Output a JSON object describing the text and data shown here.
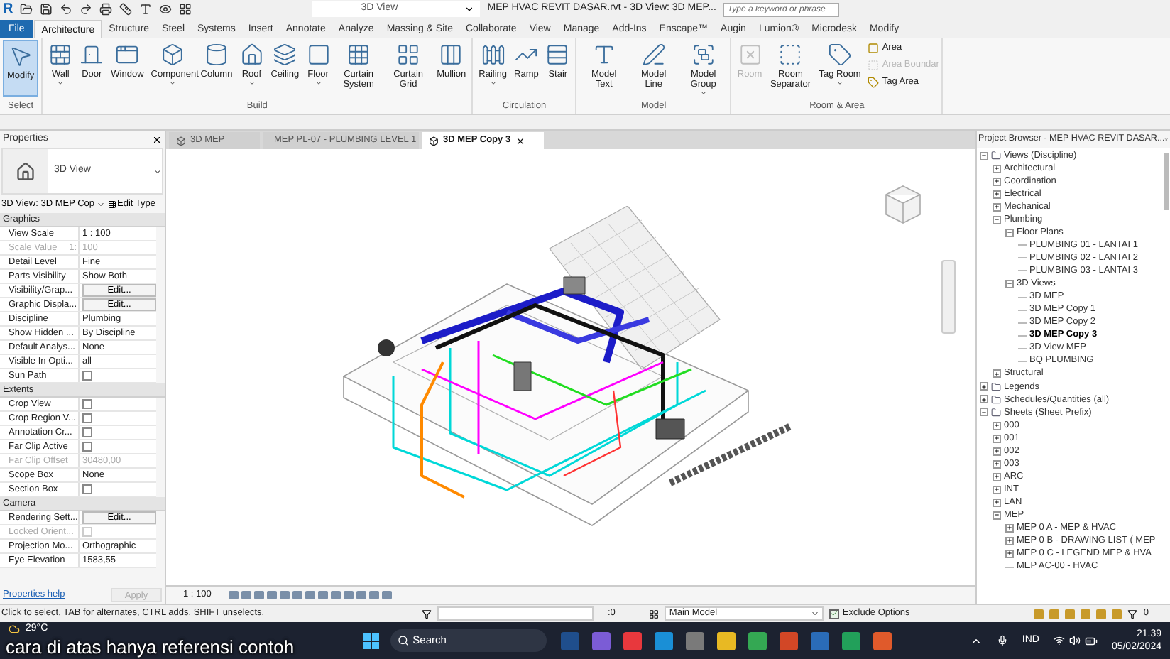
{
  "title_bar": {
    "app_logo": "R",
    "view_selector": "3D View",
    "title": "MEP HVAC REVIT DASAR.rvt - 3D View: 3D MEP...",
    "search": {
      "placeholder": "Type a keyword or phrase"
    }
  },
  "ribbon_tabs": [
    {
      "label": "File",
      "kind": "file",
      "selected": false
    },
    {
      "label": "Architecture",
      "kind": "tab",
      "selected": true
    },
    {
      "label": "Structure",
      "kind": "tab",
      "selected": false
    },
    {
      "label": "Steel",
      "kind": "tab",
      "selected": false
    },
    {
      "label": "Systems",
      "kind": "tab",
      "selected": false
    },
    {
      "label": "Insert",
      "kind": "tab",
      "selected": false
    },
    {
      "label": "Annotate",
      "kind": "tab",
      "selected": false
    },
    {
      "label": "Analyze",
      "kind": "tab",
      "selected": false
    },
    {
      "label": "Massing & Site",
      "kind": "tab",
      "selected": false
    },
    {
      "label": "Collaborate",
      "kind": "tab",
      "selected": false
    },
    {
      "label": "View",
      "kind": "tab",
      "selected": false
    },
    {
      "label": "Manage",
      "kind": "tab",
      "selected": false
    },
    {
      "label": "Add-Ins",
      "kind": "tab",
      "selected": false
    },
    {
      "label": "Enscape™",
      "kind": "tab",
      "selected": false
    },
    {
      "label": "Augin",
      "kind": "tab",
      "selected": false
    },
    {
      "label": "Lumion®",
      "kind": "tab",
      "selected": false
    },
    {
      "label": "Microdesk",
      "kind": "tab",
      "selected": false
    },
    {
      "label": "Modify",
      "kind": "tab",
      "selected": false
    }
  ],
  "ribbon_panels": [
    {
      "label": "Select",
      "buttons": [
        {
          "label": "Modify",
          "selected": true,
          "disabled": false,
          "dropdown": false
        }
      ]
    },
    {
      "label": "Build",
      "buttons": [
        {
          "label": "Wall",
          "selected": false,
          "disabled": false,
          "dropdown": true
        },
        {
          "label": "Door",
          "selected": false,
          "disabled": false,
          "dropdown": false
        },
        {
          "label": "Window",
          "selected": false,
          "disabled": false,
          "dropdown": false
        },
        {
          "label": "Component",
          "selected": false,
          "disabled": false,
          "dropdown": true
        },
        {
          "label": "Column",
          "selected": false,
          "disabled": false,
          "dropdown": false
        },
        {
          "label": "Roof",
          "selected": false,
          "disabled": false,
          "dropdown": true
        },
        {
          "label": "Ceiling",
          "selected": false,
          "disabled": false,
          "dropdown": false
        },
        {
          "label": "Floor",
          "selected": false,
          "disabled": false,
          "dropdown": true
        },
        {
          "label": "Curtain System",
          "selected": false,
          "disabled": false,
          "dropdown": false
        },
        {
          "label": "Curtain Grid",
          "selected": false,
          "disabled": false,
          "dropdown": false
        },
        {
          "label": "Mullion",
          "selected": false,
          "disabled": false,
          "dropdown": false
        }
      ]
    },
    {
      "label": "Circulation",
      "buttons": [
        {
          "label": "Railing",
          "selected": false,
          "disabled": false,
          "dropdown": true
        },
        {
          "label": "Ramp",
          "selected": false,
          "disabled": false,
          "dropdown": false
        },
        {
          "label": "Stair",
          "selected": false,
          "disabled": false,
          "dropdown": false
        }
      ]
    },
    {
      "label": "Model",
      "buttons": [
        {
          "label": "Model Text",
          "selected": false,
          "disabled": false,
          "dropdown": false
        },
        {
          "label": "Model Line",
          "selected": false,
          "disabled": false,
          "dropdown": false
        },
        {
          "label": "Model Group",
          "selected": false,
          "disabled": false,
          "dropdown": true
        }
      ]
    },
    {
      "label": "Room & Area",
      "buttons": [
        {
          "label": "Room",
          "selected": false,
          "disabled": true,
          "dropdown": false
        },
        {
          "label": "Room Separator",
          "selected": false,
          "disabled": false,
          "dropdown": false
        },
        {
          "label": "Tag Room",
          "selected": false,
          "disabled": false,
          "dropdown": true
        }
      ],
      "small_buttons": [
        {
          "label": "Area",
          "disabled": false
        },
        {
          "label": "Area Boundar",
          "disabled": true
        },
        {
          "label": "Tag Area",
          "disabled": false
        }
      ]
    }
  ],
  "properties": {
    "title": "Properties",
    "type_name": "3D View",
    "instance": "3D View: 3D MEP Cop",
    "edit_type": "Edit Type",
    "sections": [
      {
        "name": "Graphics",
        "rows": [
          {
            "label": "View Scale",
            "kind": "text",
            "value": "1 : 100",
            "disabled": false
          },
          {
            "label": "Scale Value",
            "kind": "text",
            "value_prefix": "1:",
            "value": "100",
            "disabled": true
          },
          {
            "label": "Detail Level",
            "kind": "text",
            "value": "Fine",
            "disabled": false
          },
          {
            "label": "Parts Visibility",
            "kind": "text",
            "value": "Show Both",
            "disabled": false
          },
          {
            "label": "Visibility/Grap...",
            "kind": "button",
            "value": "Edit...",
            "disabled": false
          },
          {
            "label": "Graphic Displa...",
            "kind": "button",
            "value": "Edit...",
            "disabled": false
          },
          {
            "label": "Discipline",
            "kind": "text",
            "value": "Plumbing",
            "disabled": false
          },
          {
            "label": "Show Hidden ...",
            "kind": "text",
            "value": "By Discipline",
            "disabled": false
          },
          {
            "label": "Default Analys...",
            "kind": "text",
            "value": "None",
            "disabled": false
          },
          {
            "label": "Visible In Opti...",
            "kind": "text",
            "value": "all",
            "disabled": false
          },
          {
            "label": "Sun Path",
            "kind": "checkbox",
            "checked": false,
            "disabled": false
          }
        ]
      },
      {
        "name": "Extents",
        "rows": [
          {
            "label": "Crop View",
            "kind": "checkbox",
            "checked": false,
            "disabled": false
          },
          {
            "label": "Crop Region V...",
            "kind": "checkbox",
            "checked": false,
            "disabled": false
          },
          {
            "label": "Annotation Cr...",
            "kind": "checkbox",
            "checked": false,
            "disabled": false
          },
          {
            "label": "Far Clip Active",
            "kind": "checkbox",
            "checked": false,
            "disabled": false
          },
          {
            "label": "Far Clip Offset",
            "kind": "text",
            "value": "30480,00",
            "disabled": true
          },
          {
            "label": "Scope Box",
            "kind": "text",
            "value": "None",
            "disabled": false
          },
          {
            "label": "Section Box",
            "kind": "checkbox",
            "checked": false,
            "disabled": false
          }
        ]
      },
      {
        "name": "Camera",
        "rows": [
          {
            "label": "Rendering Sett...",
            "kind": "button",
            "value": "Edit...",
            "disabled": false
          },
          {
            "label": "Locked Orient...",
            "kind": "checkbox",
            "checked": false,
            "disabled": true
          },
          {
            "label": "Projection Mo...",
            "kind": "text",
            "value": "Orthographic",
            "disabled": false
          },
          {
            "label": "Eye Elevation",
            "kind": "text",
            "value": "1583,55",
            "disabled": false
          }
        ]
      }
    ],
    "help_link": "Properties help",
    "apply": "Apply"
  },
  "view_tabs": [
    {
      "label": "3D MEP",
      "selected": false
    },
    {
      "label": "MEP PL-07 - PLUMBING LEVEL 1",
      "selected": false
    },
    {
      "label": "3D MEP Copy 3",
      "selected": true
    }
  ],
  "view_control_bar": {
    "scale": "1 : 100"
  },
  "project_browser": {
    "title": "Project Browser - MEP HVAC REVIT DASAR...",
    "tree": [
      {
        "label": "Views (Discipline)",
        "expanded": true,
        "children": [
          {
            "label": "Architectural",
            "expanded": false
          },
          {
            "label": "Coordination",
            "expanded": false
          },
          {
            "label": "Electrical",
            "expanded": false
          },
          {
            "label": "Mechanical",
            "expanded": false
          },
          {
            "label": "Plumbing",
            "expanded": true,
            "children": [
              {
                "label": "Floor Plans",
                "expanded": true,
                "children": [
                  {
                    "label": "PLUMBING 01 - LANTAI 1",
                    "selected": false
                  },
                  {
                    "label": "PLUMBING 02 - LANTAI 2",
                    "selected": false
                  },
                  {
                    "label": "PLUMBING 03 - LANTAI 3",
                    "selected": false
                  }
                ]
              },
              {
                "label": "3D Views",
                "expanded": true,
                "children": [
                  {
                    "label": "3D MEP",
                    "selected": false
                  },
                  {
                    "label": "3D MEP Copy 1",
                    "selected": false
                  },
                  {
                    "label": "3D MEP Copy 2",
                    "selected": false
                  },
                  {
                    "label": "3D MEP Copy 3",
                    "selected": true
                  },
                  {
                    "label": "3D View MEP",
                    "selected": false
                  },
                  {
                    "label": "BQ PLUMBING",
                    "selected": false
                  }
                ]
              }
            ]
          },
          {
            "label": "Structural",
            "expanded": false
          }
        ]
      },
      {
        "label": "Legends",
        "expanded": false
      },
      {
        "label": "Schedules/Quantities (all)",
        "expanded": false
      },
      {
        "label": "Sheets (Sheet Prefix)",
        "expanded": true,
        "children": [
          {
            "label": "000",
            "expanded": false
          },
          {
            "label": "001",
            "expanded": false
          },
          {
            "label": "002",
            "expanded": false
          },
          {
            "label": "003",
            "expanded": false
          },
          {
            "label": "ARC",
            "expanded": false
          },
          {
            "label": "INT",
            "expanded": false
          },
          {
            "label": "LAN",
            "expanded": false
          },
          {
            "label": "MEP",
            "expanded": true,
            "children": [
              {
                "label": "MEP 0 A - MEP & HVAC",
                "expanded": false
              },
              {
                "label": "MEP 0 B - DRAWING LIST ( MEP",
                "expanded": false
              },
              {
                "label": "MEP 0 C - LEGEND MEP & HVA",
                "expanded": false
              },
              {
                "label": "MEP AC-00 - HVAC",
                "selected": false
              }
            ]
          }
        ]
      }
    ]
  },
  "status_bar": {
    "message": "Click to select, TAB for alternates, CTRL adds, SHIFT unselects.",
    "selection_count": ":0",
    "model": "Main Model",
    "exclude_options": {
      "label": "Exclude Options",
      "checked": true
    },
    "filter_count": "0"
  },
  "taskbar": {
    "temperature": "29°C",
    "search": "Search",
    "language": "IND",
    "time": "21.39",
    "date": "05/02/2024"
  },
  "caption": "cara di atas hanya referensi contoh"
}
